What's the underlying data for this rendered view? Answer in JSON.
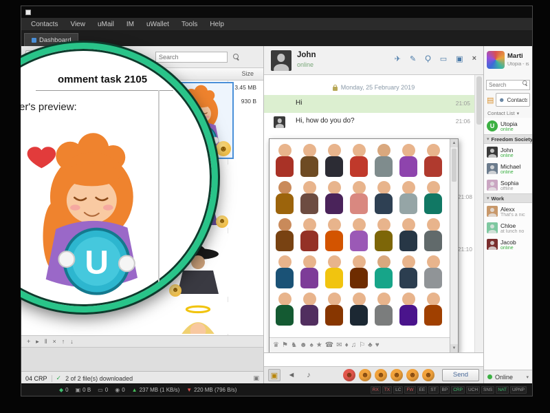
{
  "window": {
    "menu_items": [
      "Contacts",
      "View",
      "uMail",
      "IM",
      "uWallet",
      "Tools",
      "Help"
    ],
    "tab": "Dashboard"
  },
  "left_panel": {
    "search_placeholder": "Search",
    "size_header": "Size",
    "file_sizes": [
      "3.45 MB",
      "930 B"
    ],
    "transfer_icons": [
      {
        "name": "add-transfer-icon",
        "glyph": "+"
      },
      {
        "name": "start-transfer-icon",
        "glyph": "▸"
      },
      {
        "name": "pause-transfer-icon",
        "glyph": "‖"
      },
      {
        "name": "cancel-transfer-icon",
        "glyph": "×"
      },
      {
        "name": "move-up-icon",
        "glyph": "↑"
      },
      {
        "name": "move-down-icon",
        "glyph": "↓"
      }
    ],
    "downloaded_check": "✓",
    "downloaded_status": "2 of 2 file(s) downloaded",
    "balance": "04 CRP"
  },
  "lens": {
    "title": "omment task 2105",
    "preview_label": "er's preview:",
    "sticker_letter": "U"
  },
  "chat": {
    "peer_name": "John",
    "peer_status": "online",
    "header_icons": [
      {
        "name": "forward-icon",
        "glyph": "✈"
      },
      {
        "name": "edit-icon",
        "glyph": "✎"
      },
      {
        "name": "search-icon",
        "glyph": "Ϙ"
      },
      {
        "name": "screenshare-icon",
        "glyph": "▭"
      },
      {
        "name": "files-icon",
        "glyph": "▣"
      },
      {
        "name": "close-icon",
        "glyph": "×"
      }
    ],
    "date_separator": "Monday, 25 February 2019",
    "messages": [
      {
        "text": "Hi",
        "time": "21:05",
        "bg": "#dcefd0",
        "av": "none"
      },
      {
        "text": "Hi, how do you do?",
        "time": "21:06",
        "bg": "#ffffff",
        "av": "inline-block"
      }
    ],
    "side_times": [
      "21:08",
      "21:10"
    ],
    "input_icons": [
      {
        "name": "sticker-panel-icon",
        "glyph": "▣",
        "active": "1"
      },
      {
        "name": "broadcast-icon",
        "glyph": "◄",
        "active": ""
      },
      {
        "name": "microphone-icon",
        "glyph": "♪",
        "active": ""
      }
    ],
    "send_label": "Send"
  },
  "sticker_panel": {
    "tiles": [
      {
        "c1": "#e8b48c",
        "c2": "#a93226"
      },
      {
        "c1": "#e8b48c",
        "c2": "#6e4b23"
      },
      {
        "c1": "#e8b48c",
        "c2": "#2c2c34"
      },
      {
        "c1": "#e8b48c",
        "c2": "#c0392b"
      },
      {
        "c1": "#d9a87e",
        "c2": "#7f8c8d"
      },
      {
        "c1": "#e8b48c",
        "c2": "#8e44ad"
      },
      {
        "c1": "#e8b48c",
        "c2": "#b03a2e"
      },
      {
        "c1": "#c98a5a",
        "c2": "#9c640c"
      },
      {
        "c1": "#e8b48c",
        "c2": "#6d4c41"
      },
      {
        "c1": "#e8b48c",
        "c2": "#4a235a"
      },
      {
        "c1": "#e8b48c",
        "c2": "#d98880"
      },
      {
        "c1": "#e8b48c",
        "c2": "#2e4053"
      },
      {
        "c1": "#e8b48c",
        "c2": "#95a5a6"
      },
      {
        "c1": "#e8b48c",
        "c2": "#117864"
      },
      {
        "c1": "#c98a5a",
        "c2": "#784212"
      },
      {
        "c1": "#e8b48c",
        "c2": "#943126"
      },
      {
        "c1": "#e8b48c",
        "c2": "#d35400"
      },
      {
        "c1": "#e8b48c",
        "c2": "#9b59b6"
      },
      {
        "c1": "#e8b48c",
        "c2": "#7d6608"
      },
      {
        "c1": "#e8b48c",
        "c2": "#273746"
      },
      {
        "c1": "#e8b48c",
        "c2": "#616a6b"
      },
      {
        "c1": "#e8b48c",
        "c2": "#1a5276"
      },
      {
        "c1": "#e8b48c",
        "c2": "#7d3c98"
      },
      {
        "c1": "#e8b48c",
        "c2": "#f1c40f"
      },
      {
        "c1": "#e8b48c",
        "c2": "#6e2c00"
      },
      {
        "c1": "#d9a87e",
        "c2": "#17a589"
      },
      {
        "c1": "#e8b48c",
        "c2": "#2c3e50"
      },
      {
        "c1": "#e8b48c",
        "c2": "#909497"
      },
      {
        "c1": "#e8b48c",
        "c2": "#145a32"
      },
      {
        "c1": "#e8b48c",
        "c2": "#512e5f"
      },
      {
        "c1": "#e8b48c",
        "c2": "#873600"
      },
      {
        "c1": "#e8b48c",
        "c2": "#1c2833"
      },
      {
        "c1": "#e8b48c",
        "c2": "#7b7d7d"
      },
      {
        "c1": "#e8b48c",
        "c2": "#4a148c"
      },
      {
        "c1": "#e8b48c",
        "c2": "#a04000"
      }
    ],
    "categories": [
      {
        "name": "crown-icon",
        "glyph": "♛"
      },
      {
        "name": "flag-icon",
        "glyph": "⚑"
      },
      {
        "name": "knight-icon",
        "glyph": "♞"
      },
      {
        "name": "smiley-icon",
        "glyph": "☻"
      },
      {
        "name": "spade-icon",
        "glyph": "♠"
      },
      {
        "name": "star-icon",
        "glyph": "★"
      },
      {
        "name": "phone-icon",
        "glyph": "☎"
      },
      {
        "name": "mail-icon",
        "glyph": "✉"
      },
      {
        "name": "diamond-icon",
        "glyph": "♦"
      },
      {
        "name": "music-icon",
        "glyph": "♫"
      },
      {
        "name": "flag-outline-icon",
        "glyph": "⚐"
      },
      {
        "name": "club-icon",
        "glyph": "♣"
      },
      {
        "name": "heart-icon",
        "glyph": "♥"
      }
    ]
  },
  "emoji_row": [
    {
      "glyph": "☻",
      "color": "#e2574c"
    },
    {
      "glyph": "☻",
      "color": "#f2a33c"
    },
    {
      "glyph": "☻",
      "color": "#f2a33c"
    },
    {
      "glyph": "☻",
      "color": "#f2a33c"
    },
    {
      "glyph": "☻",
      "color": "#f2a33c"
    },
    {
      "glyph": "☻",
      "color": "#f2a33c"
    }
  ],
  "sidebar": {
    "profile": {
      "name": "Marti",
      "tagline": "Utopia - is the f"
    },
    "search_placeholder": "Search",
    "contacts_tab_label": "Contacts",
    "contact_list_label": "Contact List",
    "utopia": {
      "name": "Utopia",
      "sub": "online",
      "sub_color": "#3cb043",
      "letter": "U"
    },
    "group1": {
      "name": "Freedom Society",
      "members": [
        {
          "name": "John",
          "sub": "online",
          "sub_color": "#3cb043",
          "avatar_bg": "#3a3a3a"
        },
        {
          "name": "Michael",
          "sub": "online",
          "sub_color": "#3cb043",
          "avatar_bg": "#6b7b8c"
        },
        {
          "name": "Sophia",
          "sub": "offline",
          "sub_color": "#9a9a9a",
          "avatar_bg": "#caa6c2"
        }
      ]
    },
    "group2": {
      "name": "Work",
      "members": [
        {
          "name": "Alexx",
          "sub": "That's a nic",
          "sub_color": "#9a9a9a",
          "avatar_bg": "#c8986a"
        },
        {
          "name": "Chloe",
          "sub": "at lunch no",
          "sub_color": "#9a9a9a",
          "avatar_bg": "#7ec8a0"
        },
        {
          "name": "Jacob",
          "sub": "online",
          "sub_color": "#3cb043",
          "avatar_bg": "#7a2e2e"
        }
      ]
    },
    "online_status": "Online"
  },
  "statusbar": {
    "counters": [
      {
        "name": "network-icon",
        "glyph": "◆",
        "color": "#3fbf6f",
        "value": "0"
      },
      {
        "name": "storage-icon",
        "glyph": "▣",
        "color": "#9a9a9a",
        "value": "0 B"
      },
      {
        "name": "screen-icon",
        "glyph": "▭",
        "color": "#9a9a9a",
        "value": "0"
      },
      {
        "name": "peers-icon",
        "glyph": "◉",
        "color": "#9a9a9a",
        "value": "0"
      }
    ],
    "up_arrow": "▲",
    "up": "237 MB (1 KB/s)",
    "down_arrow": "▼",
    "down": "220 MB (796 B/s)",
    "indicators": [
      {
        "label": "RX",
        "color": "#d05858"
      },
      {
        "label": "TX",
        "color": "#d05858"
      },
      {
        "label": "LC",
        "color": "#9a9a9a"
      },
      {
        "label": "FW",
        "color": "#d05858"
      },
      {
        "label": "EE",
        "color": "#9a9a9a"
      },
      {
        "label": "ST",
        "color": "#9a9a9a"
      },
      {
        "label": "BP",
        "color": "#9a9a9a"
      },
      {
        "label": "CRP",
        "color": "#3fbf6f"
      },
      {
        "label": "UCH",
        "color": "#9a9a9a"
      },
      {
        "label": "SNS",
        "color": "#9a9a9a"
      },
      {
        "label": "NAT",
        "color": "#3fbf6f"
      },
      {
        "label": "UPNP",
        "color": "#9a9a9a"
      }
    ]
  },
  "glyphs": {
    "caret_down": "▾",
    "dot": "●"
  }
}
